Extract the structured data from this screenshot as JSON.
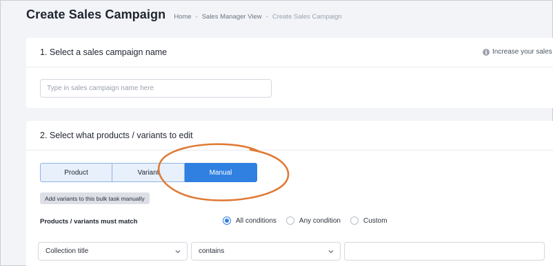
{
  "header": {
    "title": "Create Sales Campaign",
    "breadcrumb": [
      "Home",
      "Sales Manager View",
      "Create Sales Campaign"
    ],
    "separator": "-"
  },
  "section1": {
    "title": "1. Select a sales campaign name",
    "info_text": "Increase your sales",
    "name_input": {
      "value": "",
      "placeholder": "Type in sales campaign name here"
    }
  },
  "section2": {
    "title": "2. Select what products / variants to edit",
    "segments": [
      "Product",
      "Variant",
      "Manual"
    ],
    "active_segment": "Manual",
    "hint_badge": "Add variants to this bulk task manually",
    "match_label": "Products / variants must match",
    "conditions": [
      "All conditions",
      "Any condition",
      "Custom"
    ],
    "selected_condition": "All conditions",
    "filter": {
      "field": "Collection title",
      "operator": "contains",
      "value": ""
    }
  },
  "colors": {
    "accent": "#2f80e0",
    "annotation": "#e07a35",
    "background": "#f2f4f8"
  },
  "icons": [
    "info-icon",
    "chevron-down-icon"
  ]
}
